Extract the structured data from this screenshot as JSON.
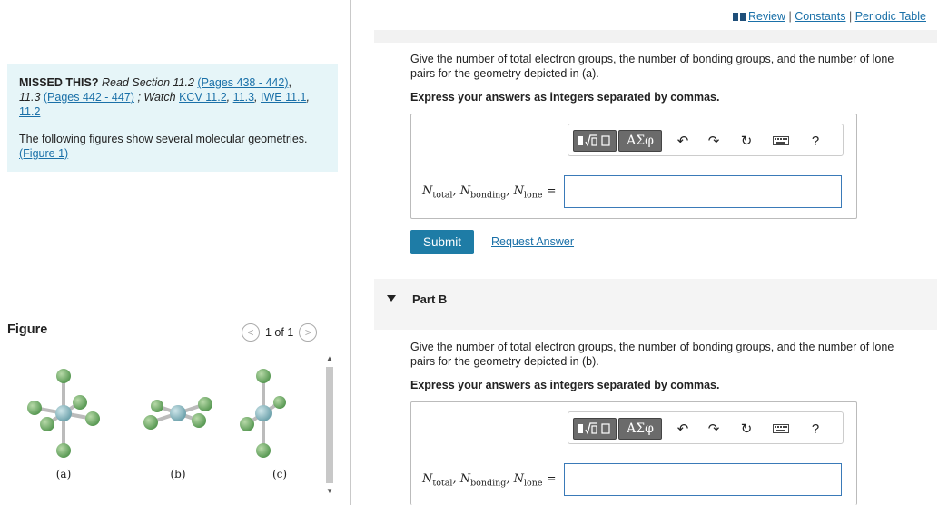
{
  "header": {
    "review": "Review",
    "constants": "Constants",
    "periodic_table": "Periodic Table",
    "sep": "|"
  },
  "missed": {
    "lead": "MISSED THIS?",
    "read_section": "Read Section 11.2",
    "pages1": "(Pages 438 - 442)",
    "comma1": ",",
    "section2": "11.3",
    "pages2": "(Pages 442 - 447)",
    "watch": "; Watch",
    "kcv1": "KCV 11.2",
    "kcv2": "11.3",
    "iwe": "IWE 11.1",
    "iwe2": "11.2",
    "para2": "The following figures show several molecular geometries.",
    "figure_link": "(Figure 1)"
  },
  "figure": {
    "label": "Figure",
    "pager": "1 of 1",
    "prev": "<",
    "next": ">",
    "captions": [
      "(a)",
      "(b)",
      "(c)"
    ]
  },
  "partA": {
    "question": "Give the number of total electron groups, the number of bonding groups, and the number of lone pairs for the geometry depicted in (a).",
    "instruction": "Express your answers as integers separated by commas.",
    "value": ""
  },
  "partB": {
    "title": "Part B",
    "question": "Give the number of total electron groups, the number of bonding groups, and the number of lone pairs for the geometry depicted in (b).",
    "instruction": "Express your answers as integers separated by commas.",
    "value": ""
  },
  "equation": {
    "n1": "N",
    "s1": "total",
    "n2": "N",
    "s2": "bonding",
    "n3": "N",
    "s3": "lone",
    "eq": "="
  },
  "toolbar": {
    "greek": "ΑΣφ",
    "help": "?"
  },
  "buttons": {
    "submit": "Submit",
    "request_answer": "Request Answer"
  }
}
